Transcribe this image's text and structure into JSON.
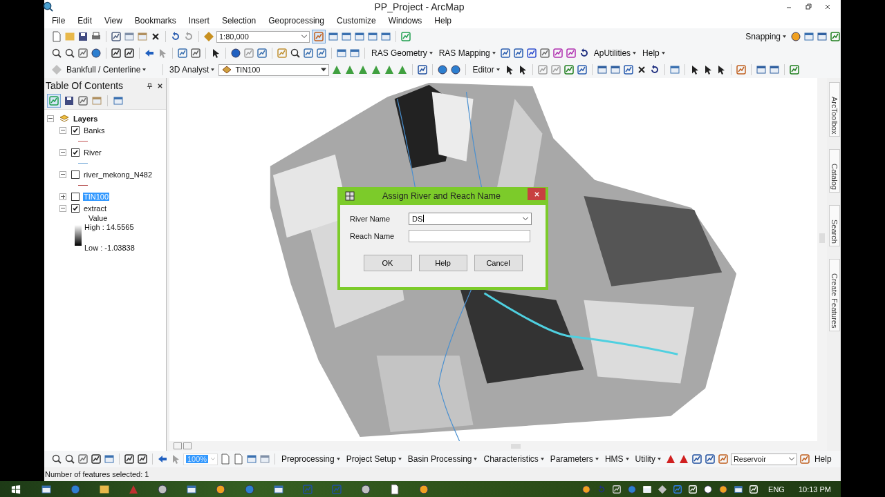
{
  "window": {
    "title": "PP_Project - ArcMap"
  },
  "menu": [
    "File",
    "Edit",
    "View",
    "Bookmarks",
    "Insert",
    "Selection",
    "Geoprocessing",
    "Customize",
    "Windows",
    "Help"
  ],
  "toolbar_1": {
    "scale": "1:80,000",
    "snapping": "Snapping"
  },
  "toolbar_2": {
    "menus": [
      "RAS Geometry",
      "RAS Mapping",
      "ApUtilities",
      "Help"
    ]
  },
  "toolbar_3": {
    "menus": [
      "Bankfull / Centerline",
      "3D Analyst"
    ],
    "layer": "TIN100",
    "editor": "Editor"
  },
  "toc": {
    "title": "Table Of Contents",
    "root": {
      "label": "Layers",
      "expanded": true,
      "children": [
        {
          "label": "Banks",
          "checked": true,
          "expanded": true,
          "selected": false,
          "color": "#c05050"
        },
        {
          "label": "River",
          "checked": true,
          "expanded": true,
          "selected": false,
          "color": "#70a8d8"
        },
        {
          "label": "river_mekong_N482",
          "checked": false,
          "expanded": true,
          "selected": false,
          "color": "#b04040"
        },
        {
          "label": "TIN100",
          "checked": false,
          "expanded": false,
          "selected": true
        },
        {
          "label": "extract",
          "checked": true,
          "expanded": true,
          "selected": false,
          "legend": {
            "title": "Value",
            "high": "High : 14.5565",
            "low": "Low : -1.03838"
          }
        }
      ]
    }
  },
  "dialog": {
    "title": "Assign River and Reach Name",
    "fields": [
      {
        "label": "River Name",
        "kind": "combo",
        "value": "DS"
      },
      {
        "label": "Reach Name",
        "kind": "text"
      }
    ],
    "buttons": [
      "OK",
      "Help",
      "Cancel"
    ]
  },
  "side_tabs": [
    "ArcToolbox",
    "Catalog",
    "Search",
    "Create Features"
  ],
  "bottom_toolbar": {
    "zoom": "100%",
    "menus": [
      "Preprocessing",
      "Project Setup",
      "Basin Processing",
      "Characteristics",
      "Parameters",
      "HMS",
      "Utility"
    ],
    "combo": "Reservoir",
    "help": "Help"
  },
  "status_bar": "Number of features selected: 1",
  "taskbar": {
    "language": "ENG",
    "clock": "10:13 PM"
  }
}
